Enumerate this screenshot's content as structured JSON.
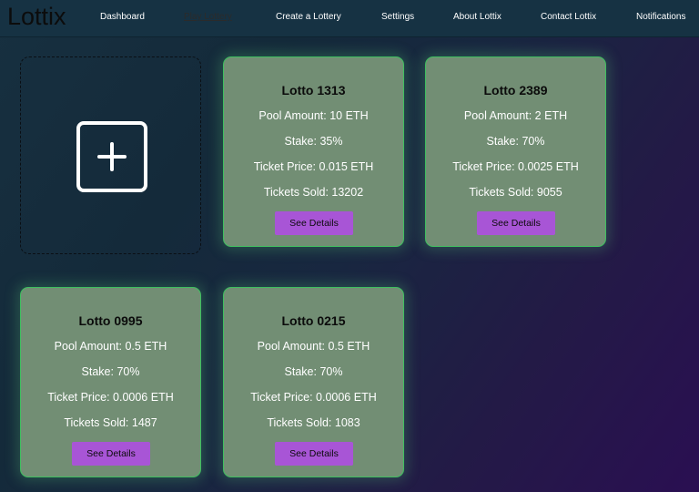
{
  "app": {
    "logo": "Lottix"
  },
  "nav": {
    "items": [
      {
        "label": "Dashboard"
      },
      {
        "label": "Play Lottery"
      },
      {
        "label": "Create a Lottery"
      },
      {
        "label": "Settings"
      },
      {
        "label": "About Lottix"
      },
      {
        "label": "Contact Lottix"
      },
      {
        "label": "Notifications"
      }
    ],
    "active": "Play Lottery"
  },
  "add_card": {
    "icon": "plus-square-icon"
  },
  "cards": [
    {
      "title": "Lotto 1313",
      "pool": "Pool Amount: 10 ETH",
      "stake": "Stake: 35%",
      "ticket_price": "Ticket Price: 0.015 ETH",
      "tickets_sold": "Tickets Sold: 13202",
      "button": "See Details"
    },
    {
      "title": "Lotto 2389",
      "pool": "Pool Amount: 2 ETH",
      "stake": "Stake: 70%",
      "ticket_price": "Ticket Price: 0.0025 ETH",
      "tickets_sold": "Tickets Sold: 9055",
      "button": "See Details"
    },
    {
      "title": "Lotto 0995",
      "pool": "Pool Amount: 0.5 ETH",
      "stake": "Stake: 70%",
      "ticket_price": "Ticket Price: 0.0006 ETH",
      "tickets_sold": "Tickets Sold: 1487",
      "button": "See Details"
    },
    {
      "title": "Lotto 0215",
      "pool": "Pool Amount: 0.5 ETH",
      "stake": "Stake: 70%",
      "ticket_price": "Ticket Price: 0.0006 ETH",
      "tickets_sold": "Tickets Sold: 1083",
      "button": "See Details"
    }
  ],
  "colors": {
    "navbar": "#163243",
    "card_bg": "#728e74",
    "card_border": "#3fbf5f",
    "button": "#a855d6"
  }
}
